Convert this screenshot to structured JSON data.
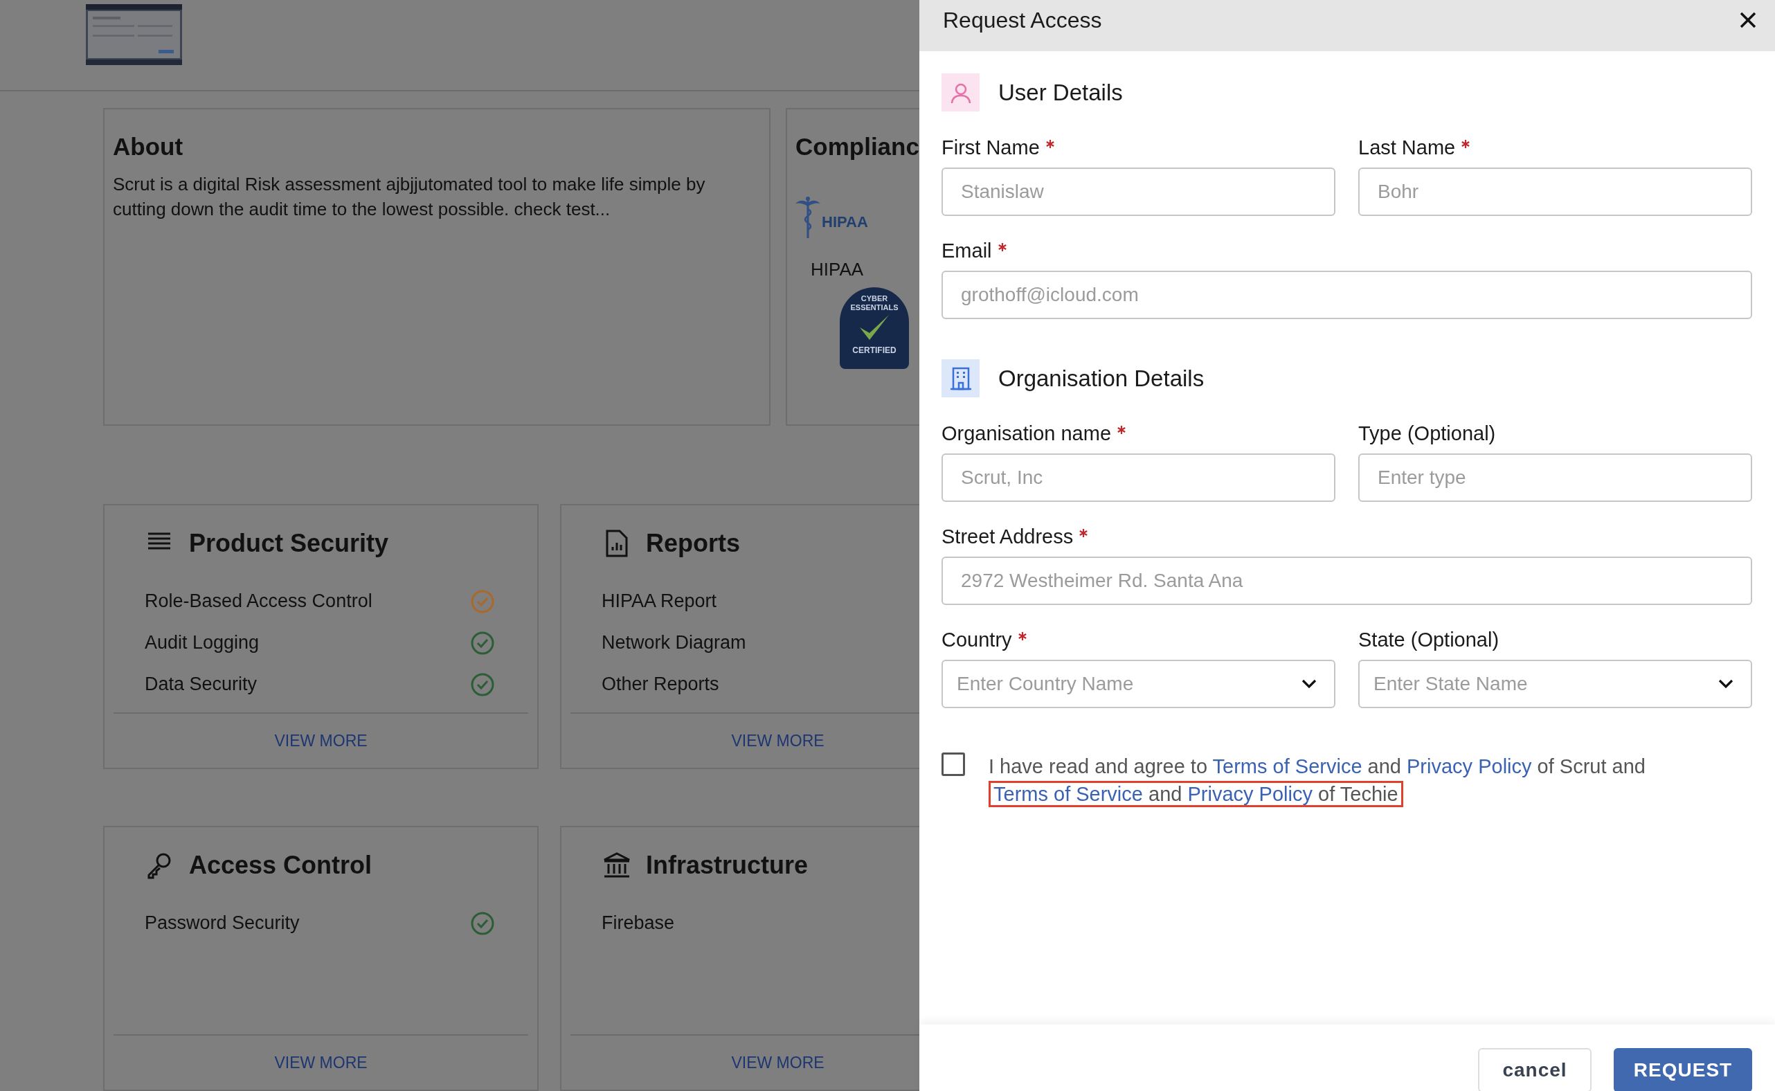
{
  "background_page": {
    "about": {
      "title": "About",
      "text": "Scrut is a digital Risk assessment ajbjjutomated tool to make life simple by cutting down the audit time to the lowest possible. check test..."
    },
    "compliance": {
      "title": "Complianc",
      "items": [
        {
          "kind": "hipaa",
          "logo_text": "HIPAA",
          "label": "HIPAA"
        },
        {
          "kind": "badge",
          "top_text": "CYBER ESSENTIALS",
          "bottom_text": "CERTIFIED"
        }
      ]
    },
    "cards": [
      {
        "kind": "list",
        "title": "Product Security",
        "items": [
          {
            "label": "Role-Based Access Control",
            "color": "#a8692a"
          },
          {
            "label": "Audit Logging",
            "color": "#2b5e37"
          },
          {
            "label": "Data Security",
            "color": "#2b5e37"
          }
        ],
        "action": "VIEW MORE"
      },
      {
        "kind": "report",
        "title": "Reports",
        "items": [
          {
            "label": "HIPAA Report"
          },
          {
            "label": "Network Diagram"
          },
          {
            "label": "Other Reports"
          }
        ],
        "action": "VIEW MORE"
      },
      {
        "kind": "key",
        "title": "Access Control",
        "items": [
          {
            "label": "Password Security",
            "color": "#2b5e37"
          }
        ],
        "action": "VIEW MORE"
      },
      {
        "kind": "bank",
        "title": "Infrastructure",
        "items": [
          {
            "label": "Firebase"
          }
        ],
        "action": "VIEW MORE"
      }
    ]
  },
  "dialog": {
    "title": "Request Access",
    "sections": [
      {
        "kind": "user",
        "heading": "User Details",
        "rows": [
          [
            {
              "kind": "text",
              "label": "First Name",
              "required": true,
              "placeholder": "Stanislaw"
            },
            {
              "kind": "text",
              "label": "Last Name",
              "required": true,
              "placeholder": "Bohr"
            }
          ],
          [
            {
              "kind": "text",
              "label": "Email",
              "required": true,
              "placeholder": "grothoff@icloud.com"
            }
          ]
        ]
      },
      {
        "kind": "organisation",
        "heading": "Organisation Details",
        "rows": [
          [
            {
              "kind": "text",
              "label": "Organisation name",
              "required": true,
              "placeholder": "Scrut, Inc"
            },
            {
              "kind": "text",
              "label": "Type (Optional)",
              "required": false,
              "placeholder": "Enter type"
            }
          ],
          [
            {
              "kind": "text",
              "label": "Street Address",
              "required": true,
              "placeholder": "2972 Westheimer Rd. Santa Ana"
            }
          ],
          [
            {
              "kind": "select",
              "label": "Country",
              "required": true,
              "placeholder": "Enter Country Name"
            },
            {
              "kind": "select",
              "label": "State (Optional)",
              "required": false,
              "placeholder": "Enter State Name"
            }
          ]
        ]
      }
    ],
    "consent": {
      "checked": false,
      "parts": [
        {
          "kind": "text",
          "text": "I have read and agree to"
        },
        {
          "kind": "link",
          "text": "Terms of Service"
        },
        {
          "kind": "text",
          "text": "and"
        },
        {
          "kind": "link",
          "text": "Privacy Policy"
        },
        {
          "kind": "text",
          "text": "of Scrut and"
        }
      ],
      "highlighted_parts": [
        {
          "kind": "link",
          "text": "Terms of Service"
        },
        {
          "kind": "text",
          "text": "and"
        },
        {
          "kind": "link",
          "text": "Privacy Policy"
        },
        {
          "kind": "text",
          "text": "of Techie"
        }
      ]
    },
    "buttons": [
      {
        "kind": "secondary",
        "label": "cancel"
      },
      {
        "kind": "primary",
        "label": "REQUEST"
      }
    ]
  }
}
